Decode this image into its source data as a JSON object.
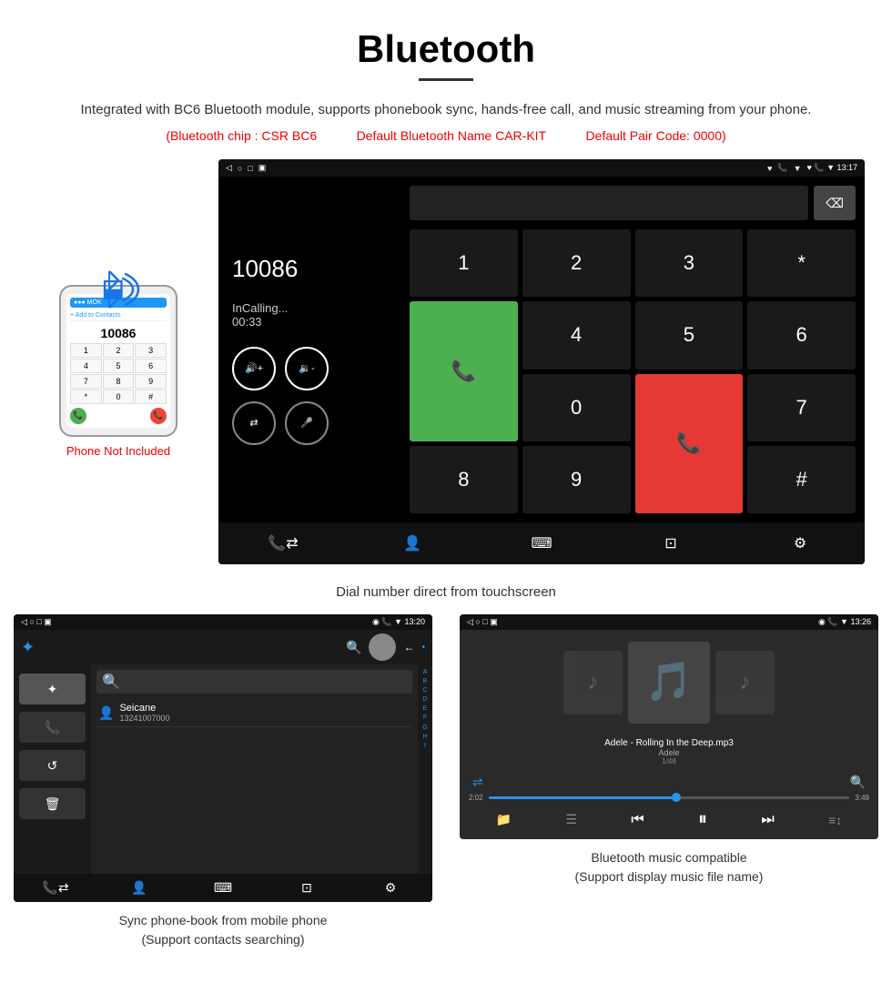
{
  "page": {
    "title": "Bluetooth",
    "subtitle": "Integrated with BC6 Bluetooth module, supports phonebook sync, hands-free call, and music streaming from your phone.",
    "chip_info": {
      "chip": "(Bluetooth chip : CSR BC6",
      "name": "Default Bluetooth Name CAR-KIT",
      "code": "Default Pair Code: 0000)"
    }
  },
  "phone_graphic": {
    "not_included": "Phone Not Included",
    "add_contact": "+ Add to Contacts",
    "number_display": "10086",
    "keys": [
      "1",
      "2",
      "3",
      "4",
      "5",
      "6",
      "7",
      "8",
      "9",
      "*",
      "0",
      "#"
    ]
  },
  "dial_screen": {
    "status_bar": {
      "left_icons": "◁  ○  □  ◫",
      "right_icons": "♥  📞  ▼  13:17"
    },
    "number": "10086",
    "status": "InCalling...",
    "timer": "00:33",
    "keys": [
      "1",
      "2",
      "3",
      "*",
      "4",
      "5",
      "6",
      "0",
      "7",
      "8",
      "9",
      "#"
    ],
    "caption": "Dial number direct from touchscreen"
  },
  "phonebook_screen": {
    "status_bar_right": "◉  📞  ▼  13:20",
    "contact_name": "Seicane",
    "contact_number": "13241007000",
    "scroll_letters": [
      "A",
      "B",
      "C",
      "D",
      "E",
      "F",
      "G",
      "H",
      "I"
    ],
    "caption_line1": "Sync phone-book from mobile phone",
    "caption_line2": "(Support contacts searching)"
  },
  "music_screen": {
    "status_bar_right": "◉  📞  ▼  13:26",
    "track": "Adele - Rolling In the Deep.mp3",
    "artist": "Adele",
    "count": "1/48",
    "time_current": "2:02",
    "time_total": "3:49",
    "progress_percent": 52,
    "caption_line1": "Bluetooth music compatible",
    "caption_line2": "(Support display music file name)"
  },
  "icons": {
    "bluetooth": "✦",
    "phone": "📞",
    "music_note": "♪",
    "volume_up": "🔊",
    "volume_down": "🔉",
    "transfer": "⇄",
    "mic": "🎤",
    "contacts": "👤",
    "keypad": "⌨",
    "settings": "⚙",
    "shuffle": "⇌",
    "search": "🔍",
    "prev": "⏮",
    "play": "▶",
    "pause": "⏸",
    "next": "⏭",
    "equalizer": "≡",
    "folder": "📁",
    "list": "☰",
    "back": "⬅",
    "call_green": "📞",
    "call_red": "📞",
    "backspace": "⌫",
    "refresh": "↺",
    "delete": "🗑",
    "transfer2": "⇄",
    "chevron_right": "›"
  }
}
